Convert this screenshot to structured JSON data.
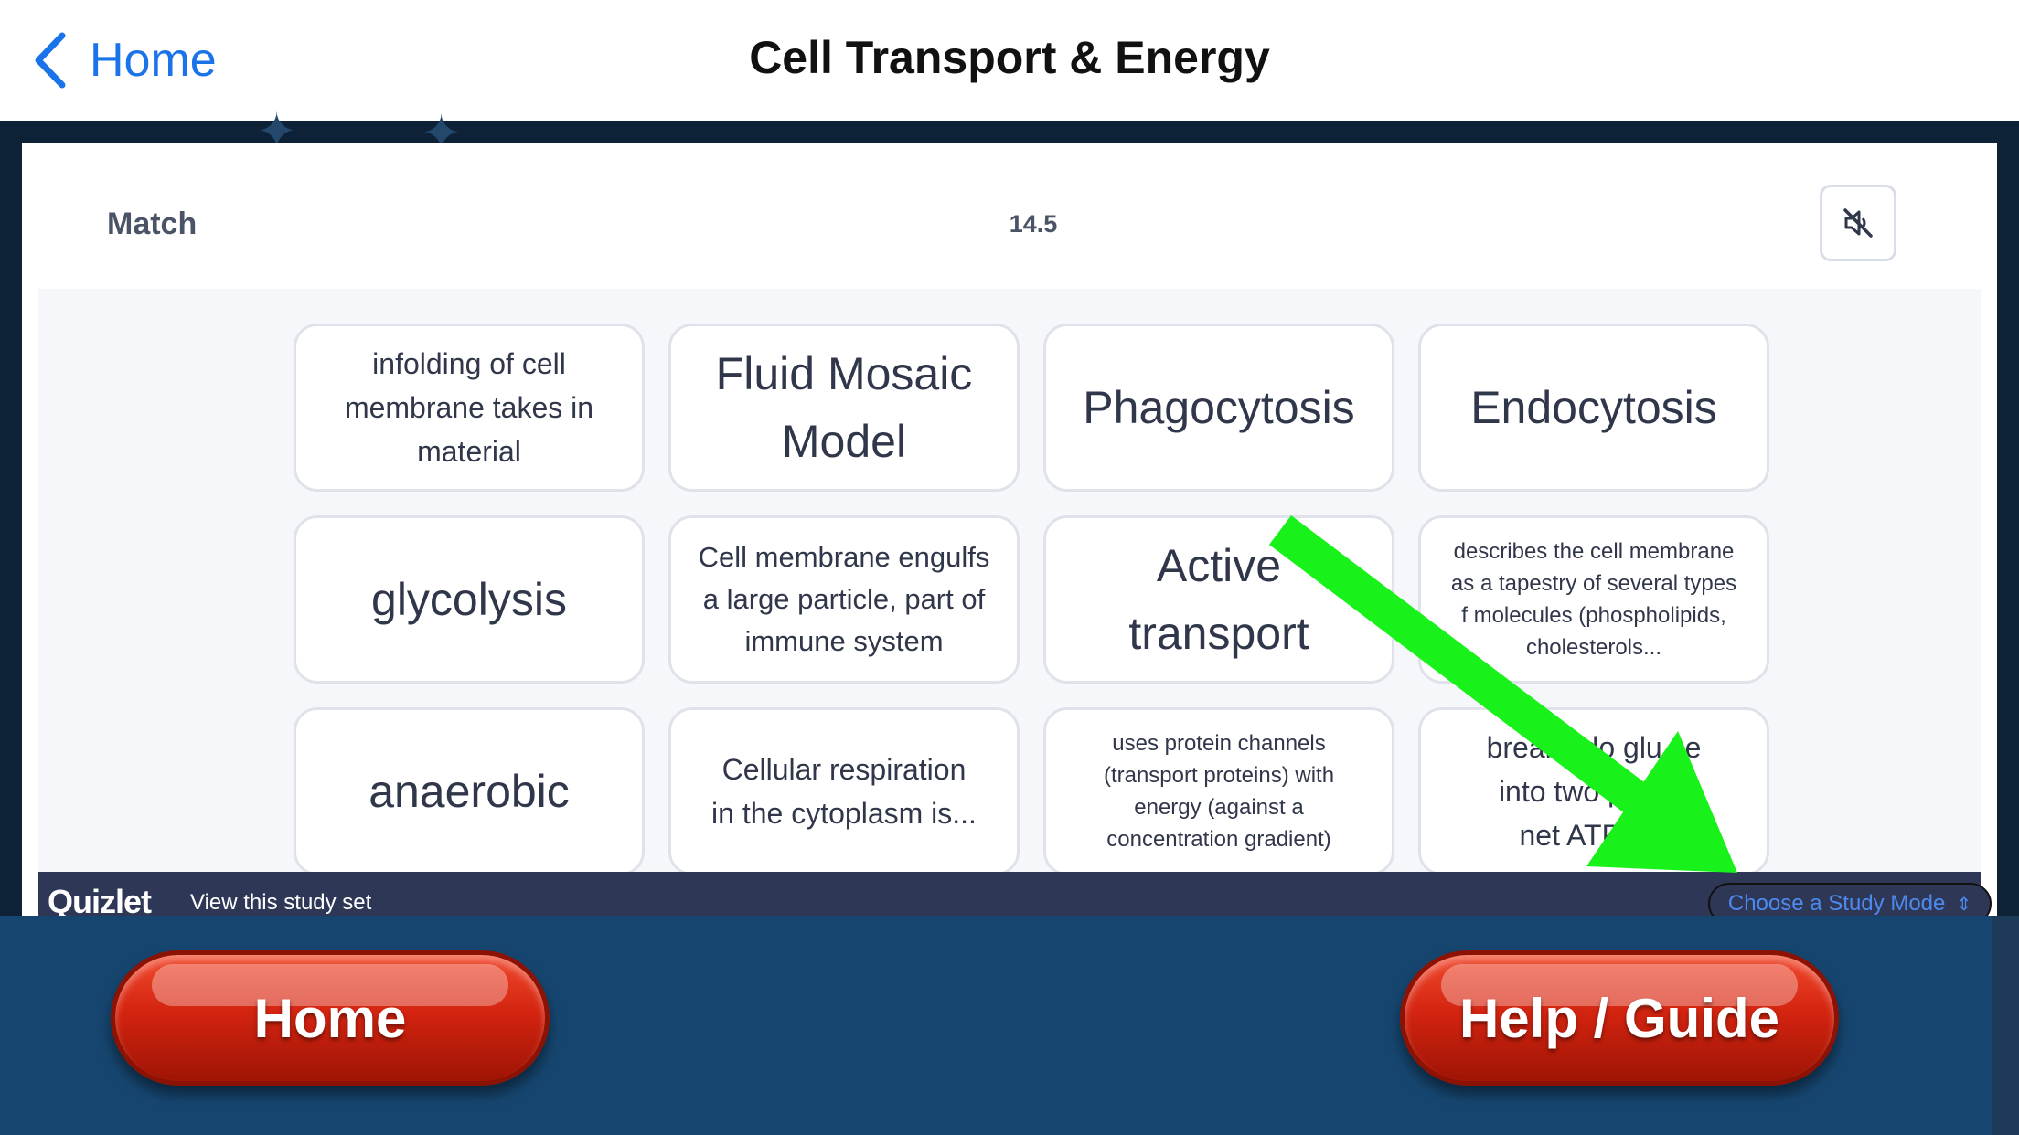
{
  "navbar": {
    "back_label": "Home",
    "title": "Cell Transport & Energy"
  },
  "match": {
    "title": "Match",
    "timer": "14.5",
    "cards": [
      {
        "text": "infolding of cell\nmembrane takes in\nmaterial"
      },
      {
        "text": "Fluid Mosaic\nModel"
      },
      {
        "text": "Phagocytosis"
      },
      {
        "text": "Endocytosis"
      },
      {
        "text": "glycolysis"
      },
      {
        "text": "Cell membrane engulfs\na large particle, part of\nimmune system"
      },
      {
        "text": "Active\ntransport"
      },
      {
        "text": "describes the cell membrane\nas a tapestry of several types\nf molecules (phospholipids,\ncholesterols..."
      },
      {
        "text": "anaerobic"
      },
      {
        "text": "Cellular respiration\nin the cytoplasm is..."
      },
      {
        "text": "uses protein channels\n(transport proteins) with\nenergy (against a\nconcentration gradient)"
      },
      {
        "text": "breaks do    glu    se\ninto two pyru      2\nnet ATPs, 2"
      }
    ]
  },
  "quizlet_bar": {
    "logo": "Quizlet",
    "view_link": "View this study set",
    "study_mode_label": "Choose a Study Mode"
  },
  "toolbar": {
    "home_label": "Home",
    "help_label": "Help / Guide"
  },
  "colors": {
    "accent_blue": "#1a73e8",
    "pill_red": "#d42410",
    "arrow_green": "#19f21a",
    "quizlet_bar": "#2e3856"
  }
}
